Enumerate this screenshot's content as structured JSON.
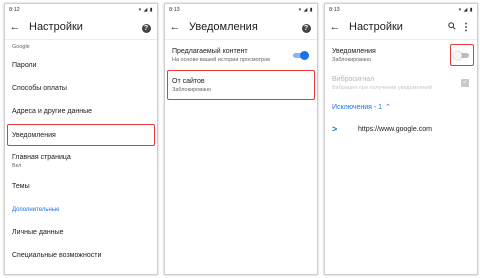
{
  "screen1": {
    "status": {
      "time": "8:12",
      "indicators": "▾ ◢ ▮"
    },
    "title": "Настройки",
    "items": [
      {
        "label": "",
        "sub": "Google"
      },
      {
        "label": "Пароли"
      },
      {
        "label": "Способы оплаты"
      },
      {
        "label": "Адреса и другие данные"
      },
      {
        "label": "Уведомления"
      },
      {
        "label": "Главная страница",
        "sub": "Вкл"
      },
      {
        "label": "Темы"
      },
      {
        "label": "Дополнительные"
      },
      {
        "label": "Личные данные"
      },
      {
        "label": "Специальные возможности"
      }
    ]
  },
  "screen2": {
    "status": {
      "time": "8:13",
      "indicators": "▾ ◢ ▮"
    },
    "title": "Уведомления",
    "items": [
      {
        "label": "Предлагаемый контент",
        "sub": "На основе вашей истории просмотров",
        "toggle": "on"
      },
      {
        "label": "От сайтов",
        "sub": "Заблокировано"
      }
    ]
  },
  "screen3": {
    "status": {
      "time": "8:13",
      "indicators": "▾ ◢ ▮"
    },
    "title": "Настройки",
    "items": [
      {
        "label": "Уведомления",
        "sub": "Заблокировано",
        "toggle": "off"
      },
      {
        "label": "Вибросигнал",
        "sub": "Вибрация при получении уведомлений"
      },
      {
        "label": "Исключения - 1"
      },
      {
        "label": "https://www.google.com"
      }
    ]
  },
  "colors": {
    "accent": "#1a73e8",
    "highlight": "#e53935"
  }
}
